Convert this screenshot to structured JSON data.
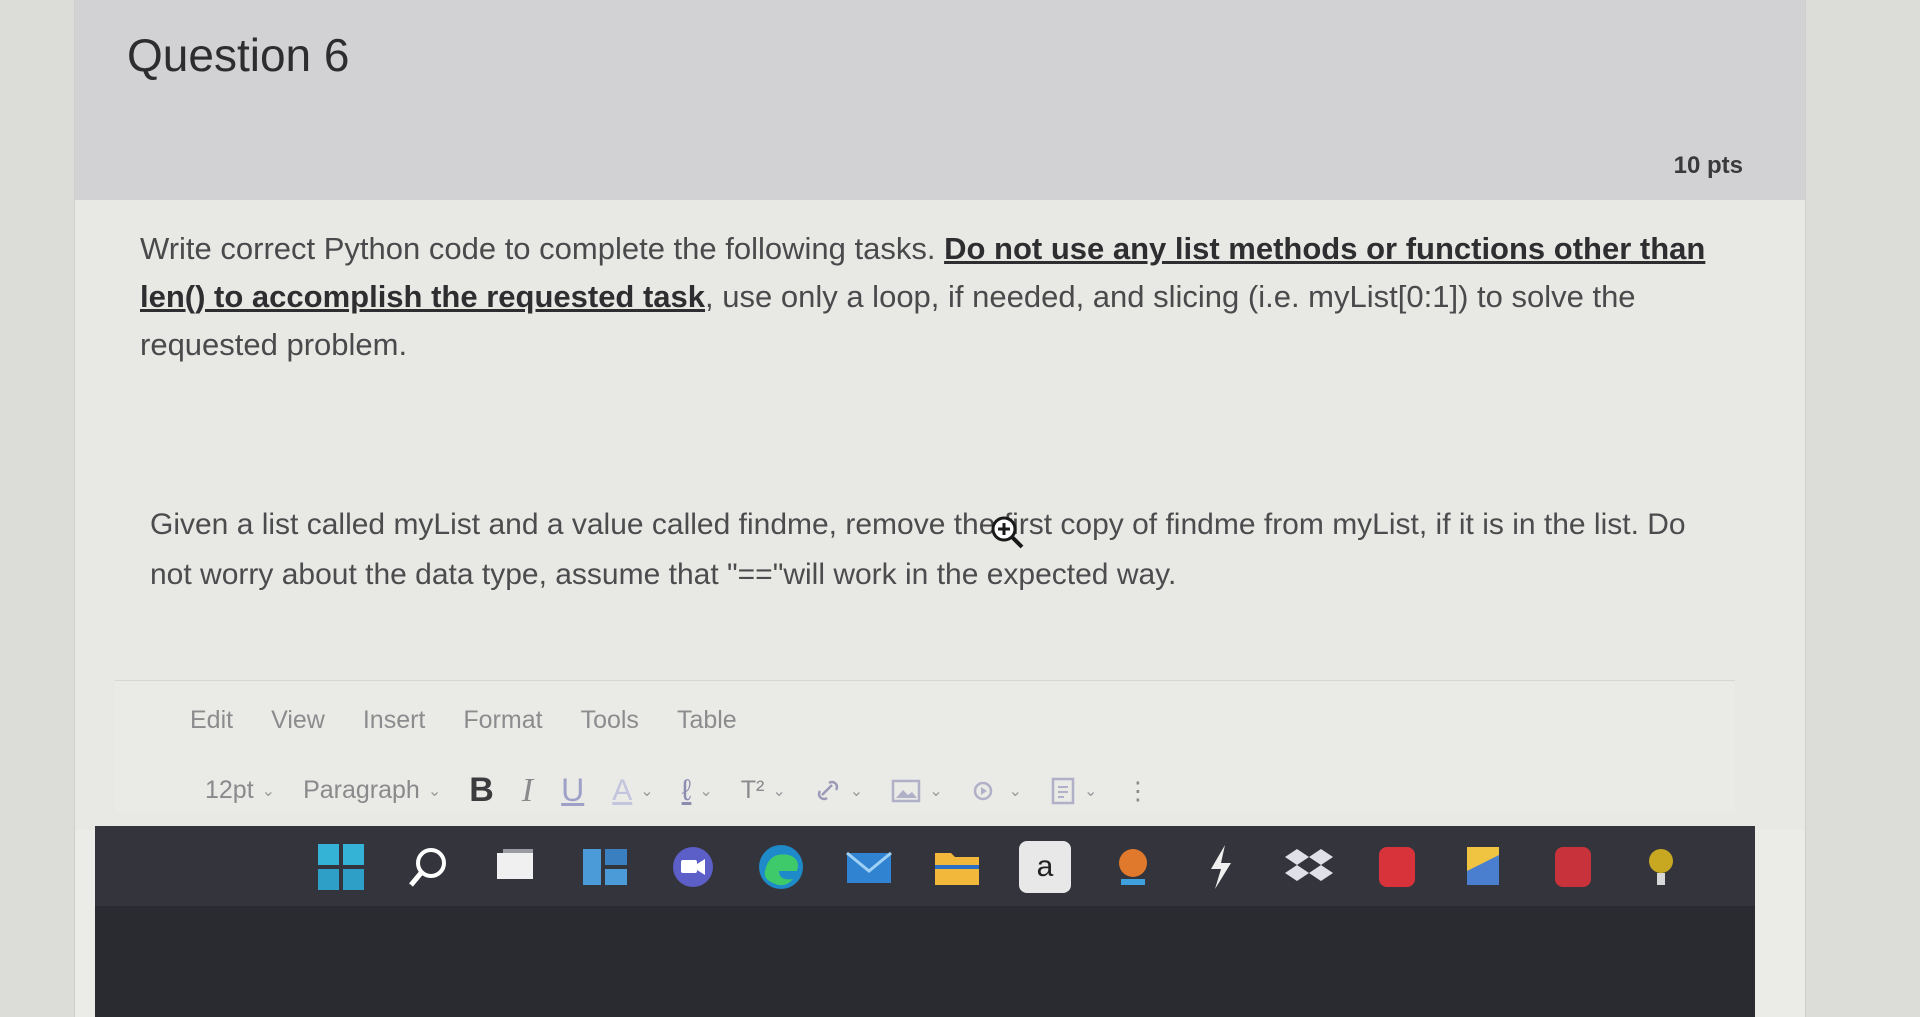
{
  "question": {
    "title": "Question 6",
    "points": "10 pts"
  },
  "instructions": {
    "part1": "Write correct Python code to complete the following tasks. ",
    "warning": "Do not use any list methods or functions other than len() to accomplish the requested task",
    "part2": ", use only a loop, if needed, and slicing (i.e. myList[0:1]) to solve the requested problem."
  },
  "task": {
    "text": "Given a list called myList and a value called findme, remove the first copy of findme from myList, if it is in the list.  Do not worry about the data type, assume that \"==\"will work in the expected way."
  },
  "editor": {
    "menu": [
      "Edit",
      "View",
      "Insert",
      "Format",
      "Tools",
      "Table"
    ],
    "font_size": "12pt",
    "block_format": "Paragraph",
    "bold": "B",
    "italic": "I",
    "underline": "U",
    "text_color": "A",
    "highlight": "ℓ",
    "superscript": "T²",
    "more": "⋮"
  },
  "taskbar": {
    "icons": [
      "start-icon",
      "search-icon",
      "task-view-icon",
      "widgets-icon",
      "chat-icon",
      "edge-icon",
      "mail-icon",
      "file-explorer-icon",
      "amazon-icon",
      "app-icon",
      "winamp-icon",
      "dropbox-icon",
      "app-icon",
      "notes-icon",
      "app-icon",
      "other-icon"
    ],
    "amazon_label": "a"
  }
}
